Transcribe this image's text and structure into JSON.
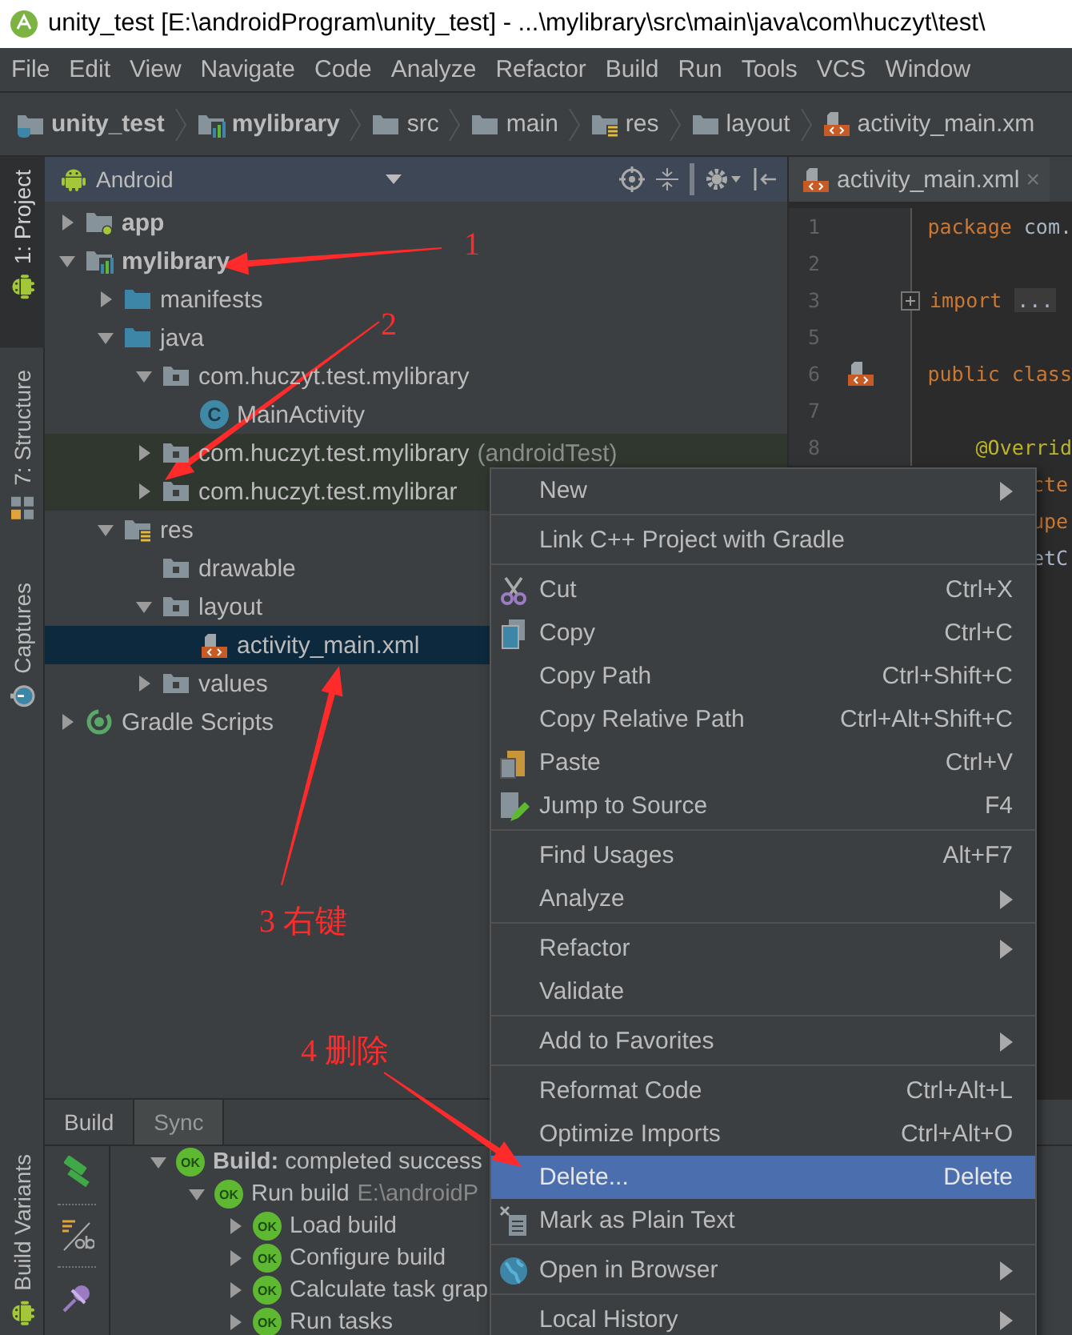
{
  "window": {
    "title": "unity_test [E:\\androidProgram\\unity_test] - ...\\mylibrary\\src\\main\\java\\com\\huczyt\\test\\"
  },
  "menu_bar": [
    "File",
    "Edit",
    "View",
    "Navigate",
    "Code",
    "Analyze",
    "Refactor",
    "Build",
    "Run",
    "Tools",
    "VCS",
    "Window"
  ],
  "breadcrumbs": [
    {
      "label": "unity_test",
      "kind": "project"
    },
    {
      "label": "mylibrary",
      "kind": "module-lib"
    },
    {
      "label": "src",
      "kind": "folder"
    },
    {
      "label": "main",
      "kind": "folder"
    },
    {
      "label": "res",
      "kind": "res-folder"
    },
    {
      "label": "layout",
      "kind": "folder"
    },
    {
      "label": "activity_main.xm",
      "kind": "xml"
    }
  ],
  "tool_windows": [
    {
      "label": "1: Project",
      "selected": true
    },
    {
      "label": "7: Structure",
      "selected": false
    },
    {
      "label": "Captures",
      "selected": false
    },
    {
      "label": "Build Variants",
      "selected": false
    }
  ],
  "project": {
    "view": "Android",
    "tree": [
      {
        "label": "app",
        "kind": "module-app",
        "expanded": false,
        "selected": false
      },
      {
        "label": "mylibrary",
        "kind": "module-lib",
        "expanded": true,
        "selected": false,
        "children": [
          {
            "label": "manifests",
            "kind": "source-folder",
            "expanded": false,
            "selected": false
          },
          {
            "label": "java",
            "kind": "source-folder",
            "expanded": true,
            "selected": false,
            "children": [
              {
                "label": "com.huczyt.test.mylibrary",
                "kind": "package",
                "expanded": true,
                "selected": false,
                "children": [
                  {
                    "label": "MainActivity",
                    "kind": "class",
                    "badge": "C",
                    "selected": false
                  }
                ]
              },
              {
                "label": "com.huczyt.test.mylibrary",
                "suffix": "(androidTest)",
                "kind": "test-package",
                "expanded": false,
                "selected": false
              },
              {
                "label": "com.huczyt.test.mylibrar",
                "kind": "test-package",
                "expanded": false,
                "selected": false
              }
            ]
          },
          {
            "label": "res",
            "kind": "res-folder",
            "expanded": true,
            "selected": false,
            "children": [
              {
                "label": "drawable",
                "kind": "package",
                "selected": false
              },
              {
                "label": "layout",
                "kind": "package",
                "expanded": true,
                "selected": false,
                "children": [
                  {
                    "label": "activity_main.xml",
                    "kind": "xml",
                    "selected": true
                  }
                ]
              },
              {
                "label": "values",
                "kind": "package",
                "expanded": false,
                "selected": false
              }
            ]
          }
        ]
      },
      {
        "label": "Gradle Scripts",
        "kind": "gradle",
        "expanded": false,
        "selected": false
      }
    ]
  },
  "editor": {
    "tab": "activity_main.xml",
    "close": "×",
    "lines": [
      {
        "number": "1",
        "tokens": [
          {
            "kind": "keyword",
            "text": "package"
          },
          {
            "kind": "plain",
            "text": "com."
          }
        ]
      },
      {
        "number": "2"
      },
      {
        "number": "3",
        "folded": true,
        "tokens": [
          {
            "kind": "keyword",
            "text": "import"
          },
          {
            "kind": "fold",
            "text": "..."
          }
        ]
      },
      {
        "number": "5"
      },
      {
        "number": "6",
        "layout_marker": true,
        "tokens": [
          {
            "kind": "keyword",
            "text": "public"
          },
          {
            "kind": "keyword",
            "text": "class"
          }
        ]
      },
      {
        "number": "7"
      },
      {
        "number": "8",
        "indented": true,
        "tokens": [
          {
            "kind": "annotation",
            "text": "@Overrid"
          }
        ]
      },
      {
        "kind": "partial",
        "tokens": [
          {
            "kind": "keyword",
            "text": "cte"
          }
        ]
      },
      {
        "kind": "partial",
        "tokens": [
          {
            "kind": "keyword",
            "text": "upe"
          }
        ]
      },
      {
        "kind": "partial",
        "tokens": [
          {
            "kind": "plain",
            "text": "etC"
          }
        ]
      }
    ]
  },
  "build_panel": {
    "tabs": [
      {
        "label": "Build",
        "selected": true
      },
      {
        "label": "Sync",
        "selected": false
      }
    ],
    "tree": [
      {
        "label": "**Build:** completed success",
        "badge": "OK",
        "expanded": true,
        "children": [
          {
            "label": "Run build",
            "detail": "E:\\androidP",
            "badge": "OK",
            "expanded": true,
            "children": [
              {
                "label": "Load build",
                "badge": "OK",
                "expanded": false
              },
              {
                "label": "Configure build",
                "badge": "OK",
                "expanded": false
              },
              {
                "label": "Calculate task grap",
                "badge": "OK",
                "expanded": false
              },
              {
                "label": "Run tasks",
                "badge": "OK",
                "expanded": false
              }
            ]
          }
        ]
      }
    ]
  },
  "context_menu": [
    {
      "label": "New",
      "submenu": true,
      "separator_before": false,
      "selected": false
    },
    {
      "label": "Link C++ Project with Gradle",
      "submenu": false,
      "separator_before": true,
      "selected": false
    },
    {
      "label": "Cut",
      "shortcut": "Ctrl+X",
      "submenu": false,
      "separator_before": true,
      "selected": false
    },
    {
      "label": "Copy",
      "shortcut": "Ctrl+C",
      "submenu": false,
      "separator_before": false,
      "selected": false
    },
    {
      "label": "Copy Path",
      "shortcut": "Ctrl+Shift+C",
      "submenu": false,
      "separator_before": false,
      "selected": false
    },
    {
      "label": "Copy Relative Path",
      "shortcut": "Ctrl+Alt+Shift+C",
      "submenu": false,
      "separator_before": false,
      "selected": false
    },
    {
      "label": "Paste",
      "shortcut": "Ctrl+V",
      "submenu": false,
      "separator_before": false,
      "selected": false
    },
    {
      "label": "Jump to Source",
      "shortcut": "F4",
      "submenu": false,
      "separator_before": false,
      "selected": false
    },
    {
      "label": "Find Usages",
      "shortcut": "Alt+F7",
      "submenu": false,
      "separator_before": true,
      "selected": false
    },
    {
      "label": "Analyze",
      "submenu": true,
      "separator_before": false,
      "selected": false
    },
    {
      "label": "Refactor",
      "submenu": true,
      "separator_before": true,
      "selected": false
    },
    {
      "label": "Validate",
      "submenu": false,
      "separator_before": false,
      "selected": false
    },
    {
      "label": "Add to Favorites",
      "submenu": true,
      "separator_before": true,
      "selected": false
    },
    {
      "label": "Reformat Code",
      "shortcut": "Ctrl+Alt+L",
      "submenu": false,
      "separator_before": true,
      "selected": false
    },
    {
      "label": "Optimize Imports",
      "shortcut": "Ctrl+Alt+O",
      "submenu": false,
      "separator_before": false,
      "selected": false
    },
    {
      "label": "Delete...",
      "shortcut": "Delete",
      "submenu": false,
      "separator_before": false,
      "selected": true
    },
    {
      "label": "Mark as Plain Text",
      "submenu": false,
      "separator_before": false,
      "selected": false
    },
    {
      "label": "Open in Browser",
      "submenu": true,
      "separator_before": true,
      "selected": false
    },
    {
      "label": "Local History",
      "submenu": true,
      "separator_before": true,
      "selected": false
    }
  ],
  "annotations": [
    {
      "text": "1"
    },
    {
      "text": "2"
    },
    {
      "text": "3 右键"
    },
    {
      "text": "4 删除"
    }
  ]
}
